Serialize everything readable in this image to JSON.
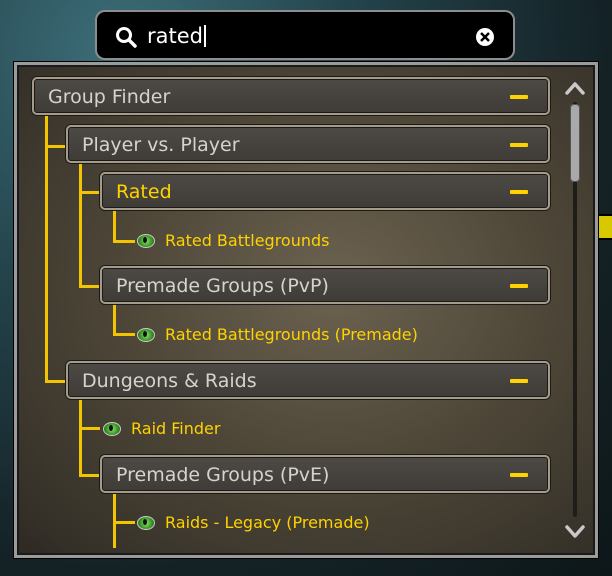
{
  "search": {
    "value": "rated"
  },
  "tree": {
    "group_finder": {
      "label": "Group Finder"
    },
    "pvp": {
      "label": "Player vs. Player"
    },
    "rated": {
      "label": "Rated"
    },
    "rated_battlegrounds": {
      "label": "Rated Battlegrounds"
    },
    "premade_pvp": {
      "label": "Premade Groups (PvP)"
    },
    "rated_battlegrounds_premade": {
      "label": "Rated Battlegrounds (Premade)"
    },
    "dungeons_raids": {
      "label": "Dungeons & Raids"
    },
    "raid_finder": {
      "label": "Raid Finder"
    },
    "premade_pve": {
      "label": "Premade Groups (PvE)"
    },
    "raids_legacy": {
      "label": "Raids - Legacy (Premade)"
    }
  },
  "colors": {
    "accent": "#ffd200",
    "tree_line": "#f3c400",
    "header_text": "#d6d3cc"
  },
  "icons": {
    "search": "search-icon",
    "clear": "clear-icon",
    "collapse": "minus-icon",
    "leaf": "eye-icon"
  }
}
